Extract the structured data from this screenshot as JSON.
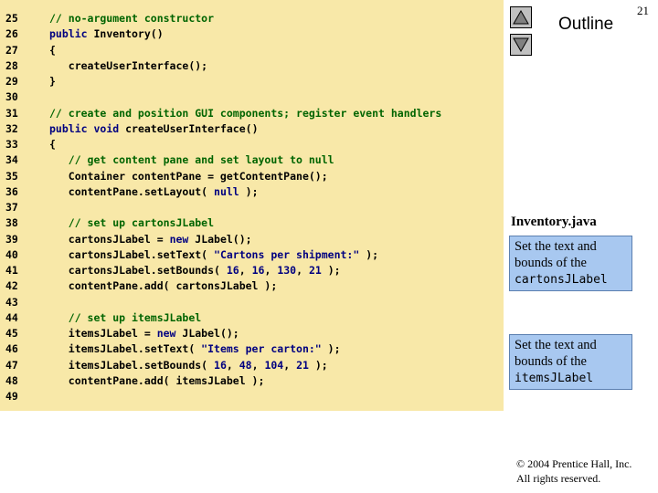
{
  "slide": {
    "page_number": "21",
    "outline_title": "Outline",
    "file_name": "Inventory.java",
    "copyright_line1": "© 2004 Prentice Hall, Inc.",
    "copyright_line2": "All rights reserved."
  },
  "nav": {
    "up_icon": "triangle-up-icon",
    "down_icon": "triangle-down-icon"
  },
  "callouts": [
    {
      "text": "Set the text and bounds of the ",
      "code": "cartonsJLabel"
    },
    {
      "text": "Set the text and bounds of the ",
      "code": "itemsJLabel"
    }
  ],
  "code": {
    "lines": [
      {
        "num": "25",
        "segments": [
          {
            "t": "// no-argument constructor",
            "c": "c"
          }
        ]
      },
      {
        "num": "26",
        "segments": [
          {
            "t": "public",
            "c": "k"
          },
          {
            "t": " Inventory()",
            "c": ""
          }
        ]
      },
      {
        "num": "27",
        "segments": [
          {
            "t": "{",
            "c": ""
          }
        ]
      },
      {
        "num": "28",
        "segments": [
          {
            "t": "   createUserInterface();",
            "c": ""
          }
        ]
      },
      {
        "num": "29",
        "segments": [
          {
            "t": "}",
            "c": ""
          }
        ]
      },
      {
        "num": "30",
        "segments": []
      },
      {
        "num": "31",
        "segments": [
          {
            "t": "// create and position GUI components; register event handlers",
            "c": "c"
          }
        ]
      },
      {
        "num": "32",
        "segments": [
          {
            "t": "public",
            "c": "k"
          },
          {
            "t": " ",
            "c": ""
          },
          {
            "t": "void",
            "c": "k"
          },
          {
            "t": " createUserInterface()",
            "c": ""
          }
        ]
      },
      {
        "num": "33",
        "segments": [
          {
            "t": "{",
            "c": ""
          }
        ]
      },
      {
        "num": "34",
        "segments": [
          {
            "t": "   ",
            "c": ""
          },
          {
            "t": "// get content pane and set layout to null",
            "c": "c"
          }
        ]
      },
      {
        "num": "35",
        "segments": [
          {
            "t": "   Container contentPane = getContentPane();",
            "c": ""
          }
        ]
      },
      {
        "num": "36",
        "segments": [
          {
            "t": "   contentPane.setLayout( ",
            "c": ""
          },
          {
            "t": "null",
            "c": "k"
          },
          {
            "t": " );",
            "c": ""
          }
        ]
      },
      {
        "num": "37",
        "segments": []
      },
      {
        "num": "38",
        "segments": [
          {
            "t": "   ",
            "c": ""
          },
          {
            "t": "// set up cartonsJLabel",
            "c": "c"
          }
        ]
      },
      {
        "num": "39",
        "segments": [
          {
            "t": "   cartonsJLabel = ",
            "c": ""
          },
          {
            "t": "new",
            "c": "k"
          },
          {
            "t": " JLabel();",
            "c": ""
          }
        ]
      },
      {
        "num": "40",
        "segments": [
          {
            "t": "   cartonsJLabel.setText( ",
            "c": ""
          },
          {
            "t": "\"Cartons per shipment:\"",
            "c": "s"
          },
          {
            "t": " );",
            "c": ""
          }
        ]
      },
      {
        "num": "41",
        "segments": [
          {
            "t": "   cartonsJLabel.setBounds( ",
            "c": ""
          },
          {
            "t": "16",
            "c": "n"
          },
          {
            "t": ", ",
            "c": ""
          },
          {
            "t": "16",
            "c": "n"
          },
          {
            "t": ", ",
            "c": ""
          },
          {
            "t": "130",
            "c": "n"
          },
          {
            "t": ", ",
            "c": ""
          },
          {
            "t": "21",
            "c": "n"
          },
          {
            "t": " );",
            "c": ""
          }
        ]
      },
      {
        "num": "42",
        "segments": [
          {
            "t": "   contentPane.add( cartonsJLabel );",
            "c": ""
          }
        ]
      },
      {
        "num": "43",
        "segments": []
      },
      {
        "num": "44",
        "segments": [
          {
            "t": "   ",
            "c": ""
          },
          {
            "t": "// set up itemsJLabel",
            "c": "c"
          }
        ]
      },
      {
        "num": "45",
        "segments": [
          {
            "t": "   itemsJLabel = ",
            "c": ""
          },
          {
            "t": "new",
            "c": "k"
          },
          {
            "t": " JLabel();",
            "c": ""
          }
        ]
      },
      {
        "num": "46",
        "segments": [
          {
            "t": "   itemsJLabel.setText( ",
            "c": ""
          },
          {
            "t": "\"Items per carton:\"",
            "c": "s"
          },
          {
            "t": " );",
            "c": ""
          }
        ]
      },
      {
        "num": "47",
        "segments": [
          {
            "t": "   itemsJLabel.setBounds( ",
            "c": ""
          },
          {
            "t": "16",
            "c": "n"
          },
          {
            "t": ", ",
            "c": ""
          },
          {
            "t": "48",
            "c": "n"
          },
          {
            "t": ", ",
            "c": ""
          },
          {
            "t": "104",
            "c": "n"
          },
          {
            "t": ", ",
            "c": ""
          },
          {
            "t": "21",
            "c": "n"
          },
          {
            "t": " );",
            "c": ""
          }
        ]
      },
      {
        "num": "48",
        "segments": [
          {
            "t": "   contentPane.add( itemsJLabel );",
            "c": ""
          }
        ]
      },
      {
        "num": "49",
        "segments": []
      }
    ]
  }
}
